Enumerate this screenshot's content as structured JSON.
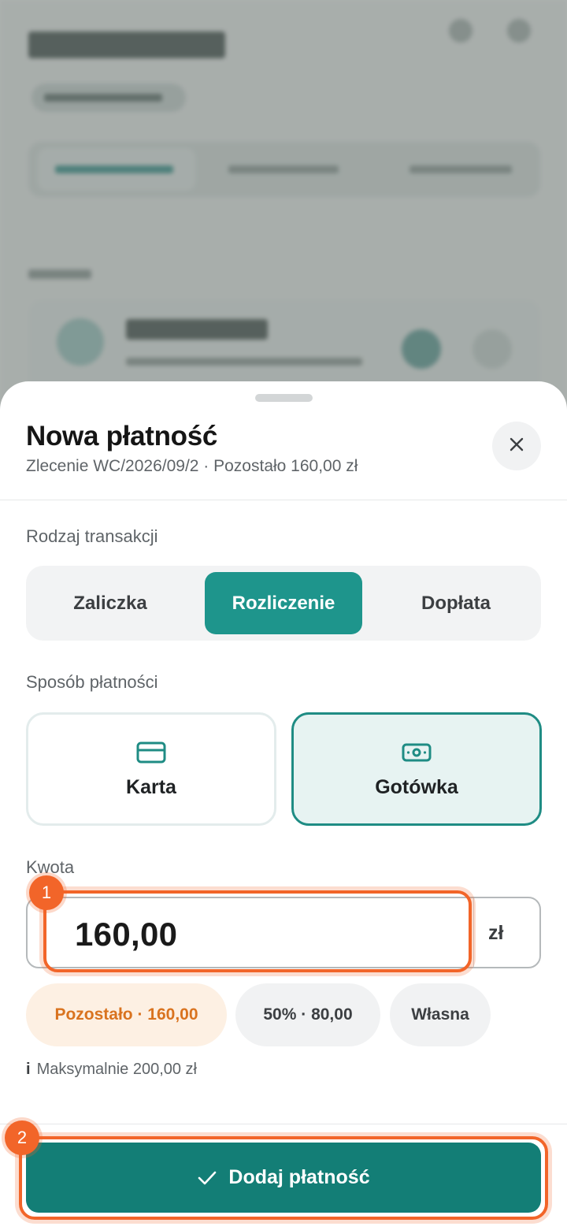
{
  "sheet": {
    "title": "Nowa płatność",
    "subtitle": "Zlecenie WC/2026/09/2 · Pozostało 160,00 zł",
    "close_icon": "close-icon"
  },
  "transaction_type": {
    "label": "Rodzaj transakcji",
    "options": [
      "Zaliczka",
      "Rozliczenie",
      "Dopłata"
    ],
    "selected": "Rozliczenie"
  },
  "payment_method": {
    "label": "Sposób płatności",
    "options": [
      {
        "label": "Karta",
        "icon": "credit-card-icon"
      },
      {
        "label": "Gotówka",
        "icon": "cash-icon"
      }
    ],
    "selected": "Gotówka"
  },
  "amount": {
    "label": "Kwota",
    "value": "160,00",
    "unit": "zł",
    "chips": [
      "Pozostało · 160,00",
      "50% · 80,00",
      "Własna"
    ],
    "hint_icon": "i",
    "hint": "Maksymalnie 200,00 zł"
  },
  "submit": {
    "label": "Dodaj płatność",
    "icon": "check-icon"
  },
  "annotations": {
    "badge_1": "1",
    "badge_2": "2"
  },
  "colors": {
    "accent": "#1e958c",
    "primary_button": "#137e76",
    "highlight": "#f26529",
    "chip_warm_bg": "#fdf0e3",
    "chip_warm_text": "#d9731f"
  }
}
